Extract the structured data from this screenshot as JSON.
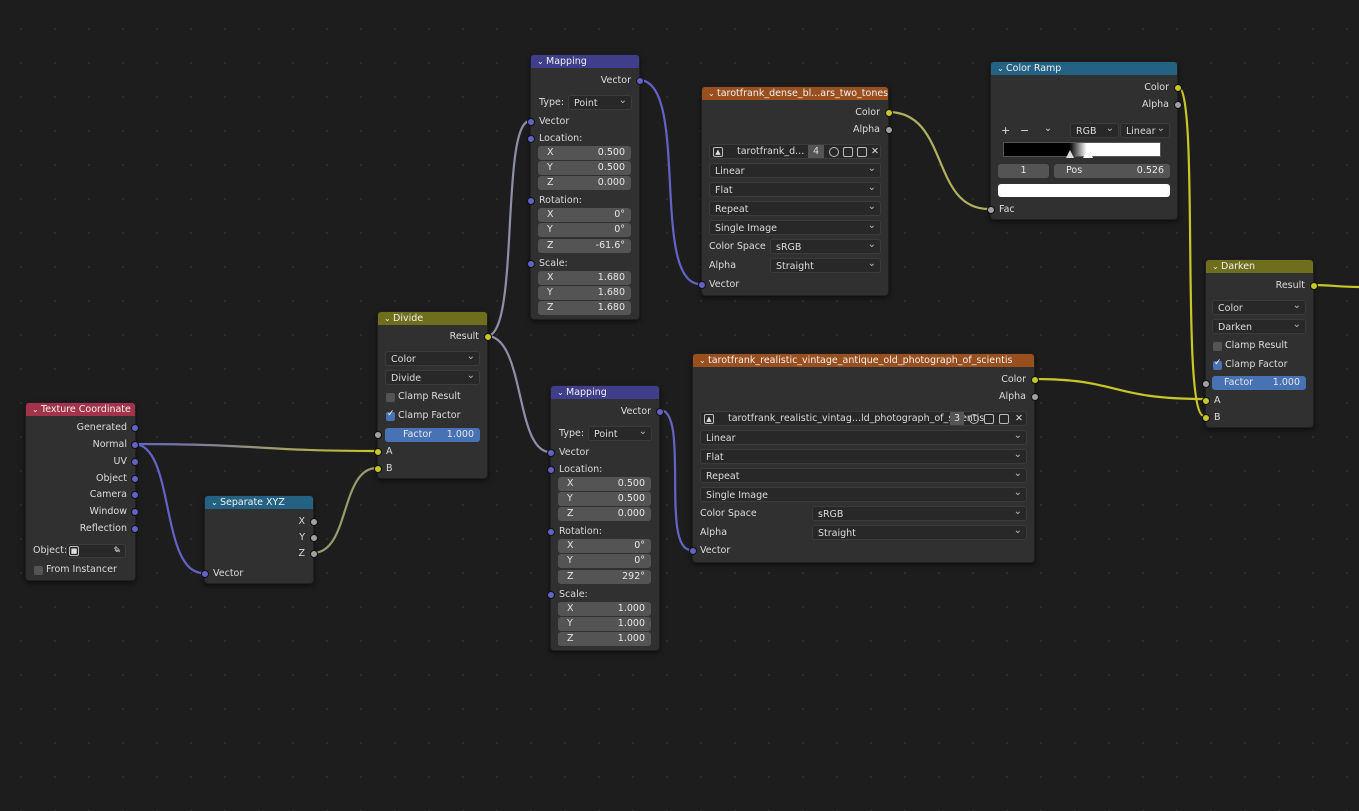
{
  "texcoord": {
    "title": "Texture Coordinate",
    "outputs": [
      "Generated",
      "Normal",
      "UV",
      "Object",
      "Camera",
      "Window",
      "Reflection"
    ],
    "object_label": "Object:",
    "from_instancer": "From Instancer"
  },
  "sepxyz": {
    "title": "Separate XYZ",
    "outputs": [
      "X",
      "Y",
      "Z"
    ],
    "input": "Vector"
  },
  "divide": {
    "title": "Divide",
    "output": "Result",
    "type": "Color",
    "op": "Divide",
    "clamp_result": "Clamp Result",
    "clamp_factor": "Clamp Factor",
    "factor_label": "Factor",
    "factor_value": "1.000",
    "in_a": "A",
    "in_b": "B"
  },
  "mapping1": {
    "title": "Mapping",
    "output": "Vector",
    "type_label": "Type:",
    "type_value": "Point",
    "input": "Vector",
    "location_label": "Location:",
    "location": [
      {
        "axis": "X",
        "value": "0.500"
      },
      {
        "axis": "Y",
        "value": "0.500"
      },
      {
        "axis": "Z",
        "value": "0.000"
      }
    ],
    "rotation_label": "Rotation:",
    "rotation": [
      {
        "axis": "X",
        "value": "0°"
      },
      {
        "axis": "Y",
        "value": "0°"
      },
      {
        "axis": "Z",
        "value": "-61.6°"
      }
    ],
    "scale_label": "Scale:",
    "scale": [
      {
        "axis": "X",
        "value": "1.680"
      },
      {
        "axis": "Y",
        "value": "1.680"
      },
      {
        "axis": "Z",
        "value": "1.680"
      }
    ]
  },
  "mapping2": {
    "title": "Mapping",
    "output": "Vector",
    "type_label": "Type:",
    "type_value": "Point",
    "input": "Vector",
    "location_label": "Location:",
    "location": [
      {
        "axis": "X",
        "value": "0.500"
      },
      {
        "axis": "Y",
        "value": "0.500"
      },
      {
        "axis": "Z",
        "value": "0.000"
      }
    ],
    "rotation_label": "Rotation:",
    "rotation": [
      {
        "axis": "X",
        "value": "0°"
      },
      {
        "axis": "Y",
        "value": "0°"
      },
      {
        "axis": "Z",
        "value": "292°"
      }
    ],
    "scale_label": "Scale:",
    "scale": [
      {
        "axis": "X",
        "value": "1.000"
      },
      {
        "axis": "Y",
        "value": "1.000"
      },
      {
        "axis": "Z",
        "value": "1.000"
      }
    ]
  },
  "img1": {
    "title": "tarotfrank_dense_bl...ars_two_tones_only",
    "out_color": "Color",
    "out_alpha": "Alpha",
    "image_name": "tarotfrank_d...",
    "users": "4",
    "interp": "Linear",
    "projection": "Flat",
    "extension": "Repeat",
    "source": "Single Image",
    "cs_label": "Color Space",
    "cs_value": "sRGB",
    "alpha_label": "Alpha",
    "alpha_value": "Straight",
    "input": "Vector"
  },
  "img2": {
    "title": "tarotfrank_realistic_vintage_antique_old_photograph_of_scientis",
    "out_color": "Color",
    "out_alpha": "Alpha",
    "image_name": "tarotfrank_realistic_vintag...ld_photograph_of_scientis",
    "users": "3",
    "interp": "Linear",
    "projection": "Flat",
    "extension": "Repeat",
    "source": "Single Image",
    "cs_label": "Color Space",
    "cs_value": "sRGB",
    "alpha_label": "Alpha",
    "alpha_value": "Straight",
    "input": "Vector"
  },
  "ramp": {
    "title": "Color Ramp",
    "out_color": "Color",
    "out_alpha": "Alpha",
    "add": "+",
    "remove": "−",
    "menu": "⌄",
    "mode": "RGB",
    "interp": "Linear",
    "index": "1",
    "pos_label": "Pos",
    "pos_value": "0.526",
    "input": "Fac"
  },
  "darken": {
    "title": "Darken",
    "output": "Result",
    "type": "Color",
    "op": "Darken",
    "clamp_result": "Clamp Result",
    "clamp_factor": "Clamp Factor",
    "factor_label": "Factor",
    "factor_value": "1.000",
    "in_a": "A",
    "in_b": "B"
  },
  "colors": {
    "vector_socket": "#6363c7",
    "color_socket": "#c7c729",
    "float_socket": "#a1a1a1"
  }
}
